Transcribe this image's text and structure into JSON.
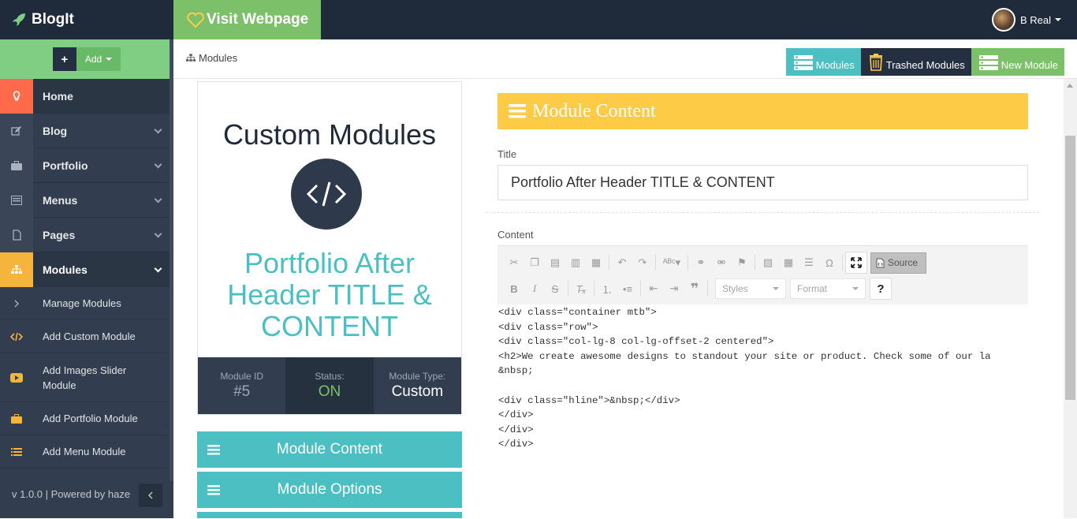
{
  "topbar": {
    "brand": "BlogIt",
    "visit_label": "Visit Webpage",
    "user_name": "B Real"
  },
  "sidebar": {
    "add_label": "Add",
    "items": [
      {
        "label": "Home",
        "icon": "bulb-icon"
      },
      {
        "label": "Blog",
        "icon": "edit-icon"
      },
      {
        "label": "Portfolio",
        "icon": "briefcase-icon"
      },
      {
        "label": "Menus",
        "icon": "menu-icon"
      },
      {
        "label": "Pages",
        "icon": "page-icon"
      },
      {
        "label": "Modules",
        "icon": "sitemap-icon"
      }
    ],
    "subitems": [
      {
        "label": "Manage Modules",
        "icon": "chevron-right-icon"
      },
      {
        "label": "Add Custom Module",
        "icon": "code-icon"
      },
      {
        "label": "Add Images Slider Module",
        "icon": "youtube-icon"
      },
      {
        "label": "Add Portfolio Module",
        "icon": "briefcase-icon"
      },
      {
        "label": "Add Menu Module",
        "icon": "list-icon"
      }
    ],
    "footer": "v 1.0.0 | Powered by haze"
  },
  "breadcrumb": "Modules",
  "toolbar": {
    "modules": "Modules",
    "trashed": "Trashed Modules",
    "new_module": "New Module"
  },
  "card": {
    "heading": "Custom Modules",
    "name": "Portfolio After Header TITLE & CONTENT",
    "stats": [
      {
        "label": "Module ID",
        "value": "#5"
      },
      {
        "label": "Status:",
        "value": "ON"
      },
      {
        "label": "Module Type:",
        "value": "Custom"
      }
    ]
  },
  "side_buttons": [
    "Module Content",
    "Module Options"
  ],
  "panel": {
    "title": "Module Content",
    "title_label": "Title",
    "title_value": "Portfolio After Header TITLE & CONTENT",
    "content_label": "Content"
  },
  "editor": {
    "source_label": "Source",
    "styles_label": "Styles",
    "format_label": "Format",
    "help_label": "?",
    "code": "<div class=\"container mtb\">\n<div class=\"row\">\n<div class=\"col-lg-8 col-lg-offset-2 centered\">\n<h2>We create awesome designs to standout your site or product. Check some of our la\n&nbsp;\n\n<div class=\"hline\">&nbsp;</div>\n</div>\n</div>\n</div>"
  },
  "colors": {
    "accent_teal": "#4bbfc1",
    "accent_green": "#7dc06a",
    "accent_yellow": "#fecb47",
    "accent_orange": "#ff6b4a",
    "status_on": "#7dc06a",
    "dark": "#1f2a3a"
  }
}
